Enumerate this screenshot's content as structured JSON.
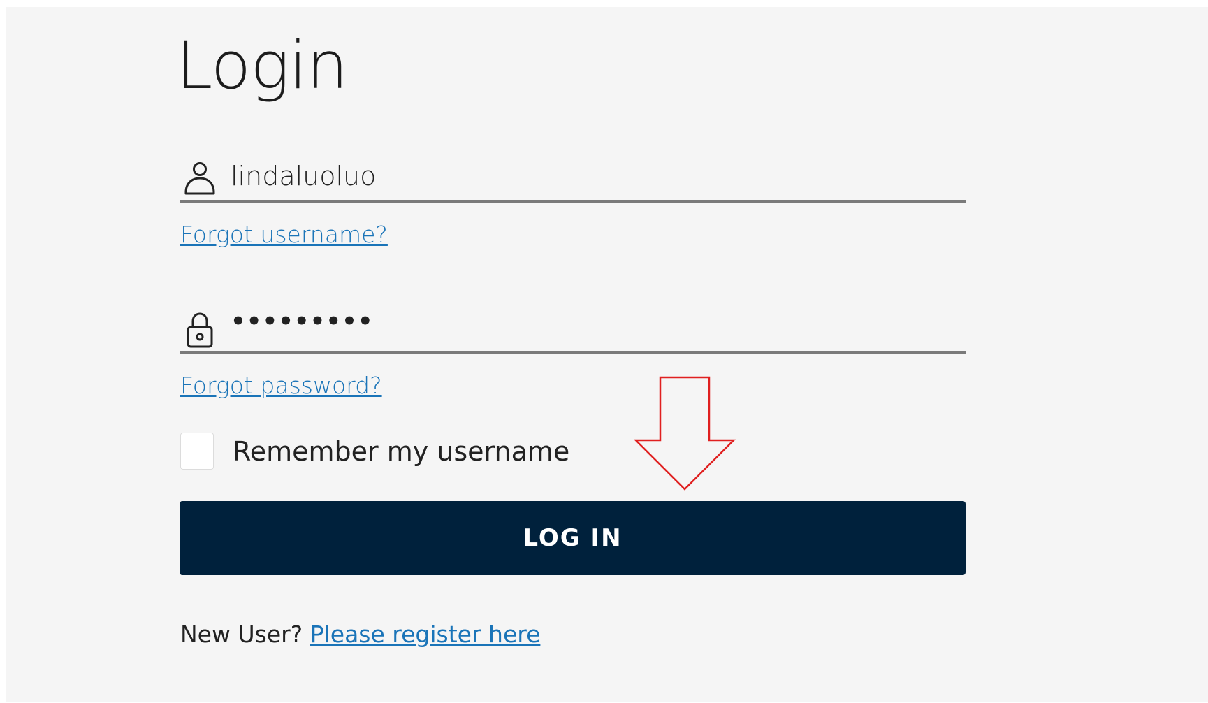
{
  "page": {
    "title": "Login"
  },
  "username": {
    "icon": "user-icon",
    "value": "lindaluoluo",
    "forgot_link": "Forgot username?"
  },
  "password": {
    "icon": "lock-icon",
    "value": "•••••••••",
    "forgot_link": "Forgot password?"
  },
  "remember": {
    "label": "Remember my username",
    "checked": false
  },
  "login_button": {
    "label": "LOG IN"
  },
  "register": {
    "prompt": "New User?",
    "link": "Please register here"
  },
  "annotation": {
    "icon": "down-arrow-icon",
    "color": "#e02020"
  },
  "colors": {
    "button_bg": "#00213c",
    "link": "#1a74b8",
    "background": "#f5f5f5"
  }
}
